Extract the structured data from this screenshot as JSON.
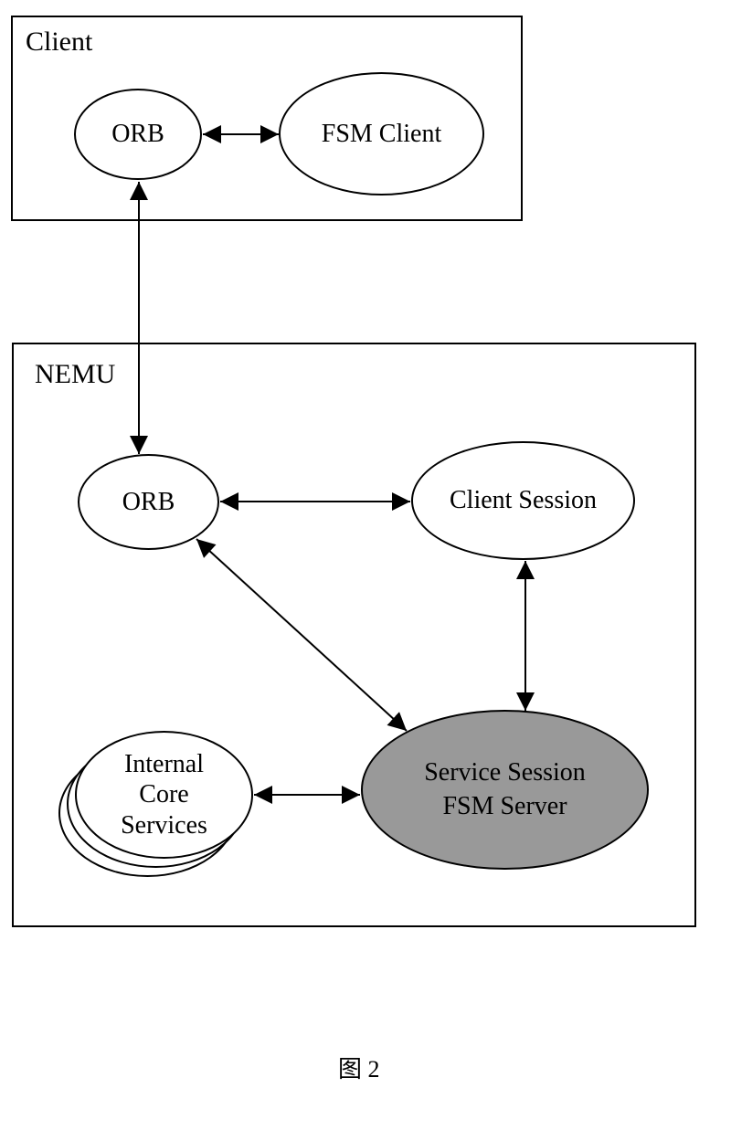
{
  "diagram": {
    "boxes": {
      "client": {
        "label": "Client"
      },
      "nemu": {
        "label": "NEMU"
      }
    },
    "nodes": {
      "orb_client": {
        "label": "ORB"
      },
      "fsm_client": {
        "label": "FSM Client"
      },
      "orb_nemu": {
        "label": "ORB"
      },
      "client_session": {
        "label": "Client Session"
      },
      "internal_core": {
        "label": "Internal\nCore\nServices"
      },
      "service_session": {
        "label": "Service Session\nFSM Server"
      }
    },
    "figure_label": "图 2"
  }
}
